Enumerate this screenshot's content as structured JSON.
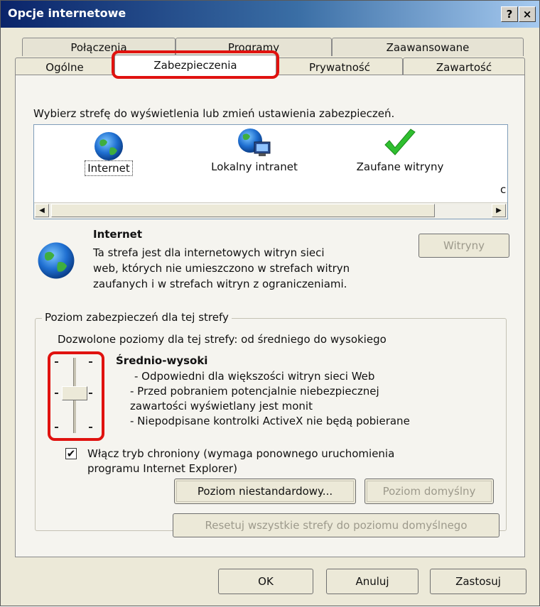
{
  "window": {
    "title": "Opcje internetowe",
    "help_label": "?",
    "close_label": "×"
  },
  "tabs": {
    "row1": [
      "Połączenia",
      "Programy",
      "Zaawansowane"
    ],
    "row2": [
      "Ogólne",
      "Zabezpieczenia",
      "Prywatność",
      "Zawartość"
    ],
    "active": "Zabezpieczenia"
  },
  "zones": {
    "instruction": "Wybierz strefę do wyświetlenia lub zmień ustawienia zabezpieczeń.",
    "items": [
      {
        "label": "Internet",
        "icon": "globe-icon",
        "selected": true
      },
      {
        "label": "Lokalny intranet",
        "icon": "intranet-globe-icon",
        "selected": false
      },
      {
        "label": "Zaufane witryny",
        "icon": "checkmark-icon",
        "selected": false
      }
    ],
    "overflow_char": "c"
  },
  "zone_info": {
    "title": "Internet",
    "description": [
      "Ta strefa jest dla internetowych witryn sieci",
      "web, których nie umieszczono w strefach witryn",
      "zaufanych i w strefach witryn z ograniczeniami."
    ],
    "sites_button": "Witryny"
  },
  "security_level": {
    "group_title": "Poziom zabezpieczeń dla tej strefy",
    "allowed": "Dozwolone poziomy dla tej strefy: od średniego do wysokiego",
    "level_name": "Średnio-wysoki",
    "bullets": [
      "- Odpowiedni dla większości witryn sieci Web",
      "- Przed pobraniem potencjalnie niebezpiecznej",
      "zawartości wyświetlany jest monit",
      "- Niepodpisane kontrolki ActiveX nie będą pobierane"
    ],
    "protected_mode_checked": true,
    "protected_mode_label": [
      "Włącz tryb chroniony (wymaga ponownego uruchomienia",
      "programu Internet Explorer)"
    ],
    "custom_button": "Poziom niestandardowy...",
    "default_button": "Poziom domyślny",
    "reset_button": "Resetuj wszystkie strefy do poziomu domyślnego"
  },
  "footer": {
    "ok": "OK",
    "cancel": "Anuluj",
    "apply": "Zastosuj"
  },
  "colors": {
    "highlight": "#e0120f",
    "titlebar_start": "#0a246a",
    "check_green": "#2fbf2f"
  }
}
